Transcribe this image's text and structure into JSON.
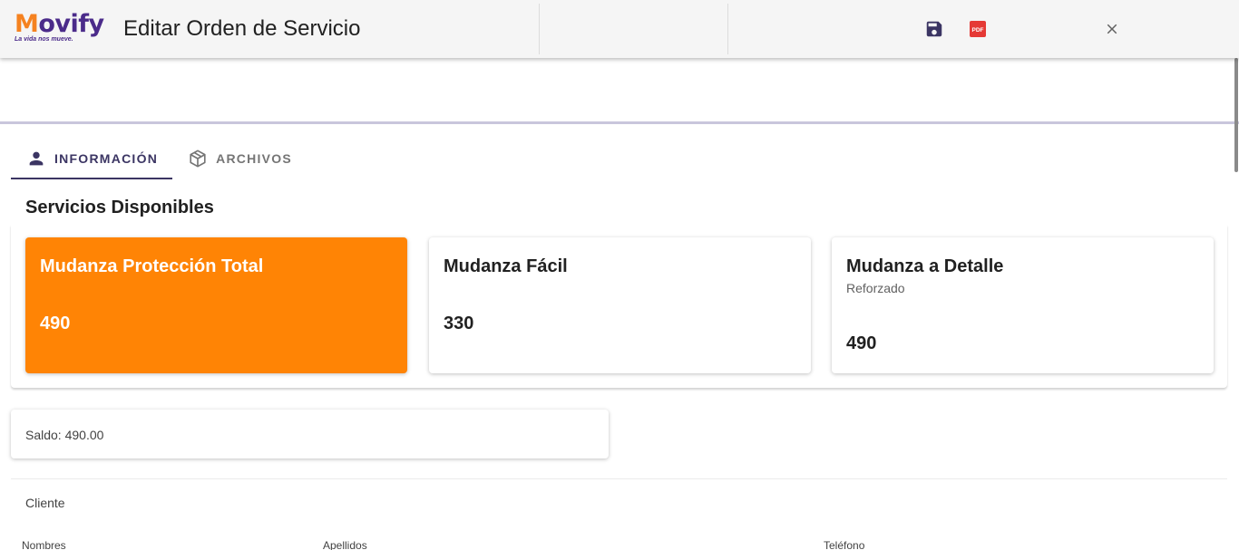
{
  "app": {
    "logo_text": "ovify",
    "logo_initial": "M",
    "logo_tagline": "La vida nos mueve.",
    "title": "Editar Orden de Servicio",
    "brand_color": "#4b2b8a",
    "accent_color": "#ff8405"
  },
  "toolbar": {
    "save_icon": "save-icon",
    "pdf_icon": "pdf-icon",
    "pdf_label": "PDF",
    "close_icon": "close-icon"
  },
  "tabs": [
    {
      "label": "INFORMACIÓN",
      "icon": "person-icon",
      "active": true
    },
    {
      "label": "ARCHIVOS",
      "icon": "box-icon",
      "active": false
    }
  ],
  "services": {
    "title": "Servicios Disponibles",
    "items": [
      {
        "name": "Mudanza Protección Total",
        "subtitle": "",
        "price": "490",
        "selected": true
      },
      {
        "name": "Mudanza Fácil",
        "subtitle": "",
        "price": "330",
        "selected": false
      },
      {
        "name": "Mudanza a Detalle",
        "subtitle": "Reforzado",
        "price": "490",
        "selected": false
      }
    ]
  },
  "saldo": {
    "text": "Saldo: 490.00"
  },
  "cliente": {
    "section_label": "Cliente",
    "fields": {
      "nombres": "Nombres",
      "apellidos": "Apellidos",
      "telefono": "Teléfono"
    }
  }
}
